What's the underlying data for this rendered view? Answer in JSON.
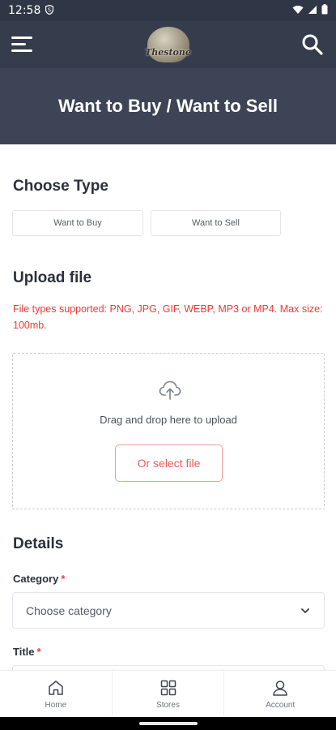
{
  "status_bar": {
    "time": "12:58",
    "notification_icon": "s-shield-icon",
    "icons": [
      "wifi-icon",
      "signal-icon",
      "battery-icon"
    ]
  },
  "app_bar": {
    "logo_text": "Thestone",
    "menu_icon": "menu-icon",
    "search_icon": "search-icon"
  },
  "hero": {
    "title": "Want to Buy / Want to Sell"
  },
  "choose_type": {
    "title": "Choose Type",
    "options": [
      "Want to Buy",
      "Want to Sell"
    ]
  },
  "upload": {
    "title": "Upload file",
    "hint": "File types supported: PNG, JPG, GIF, WEBP, MP3 or MP4. Max size: 100mb.",
    "dropzone_text": "Drag and drop here to upload",
    "select_button": "Or select file",
    "icon": "cloud-upload-icon"
  },
  "details": {
    "title": "Details",
    "category_label": "Category",
    "required_mark": "*",
    "category_placeholder": "Choose category",
    "title_label": "Title"
  },
  "bottom_nav": {
    "items": [
      {
        "label": "Home",
        "icon": "home-icon"
      },
      {
        "label": "Stores",
        "icon": "grid-icon"
      },
      {
        "label": "Account",
        "icon": "user-icon"
      }
    ]
  },
  "colors": {
    "header_bg": "#353d4d",
    "hero_bg": "#3c4455",
    "accent_red": "#ee3a3a"
  }
}
